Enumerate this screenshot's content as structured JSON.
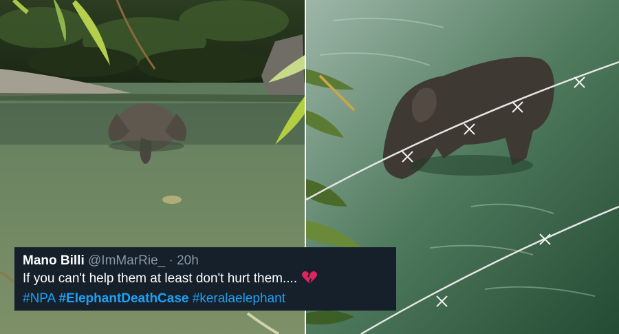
{
  "photos": {
    "left": {
      "icon": "elephant-in-river-photo"
    },
    "right": {
      "icon": "elephant-behind-barbed-wire-photo"
    }
  },
  "tweet": {
    "display_name": "Mano Billi",
    "handle": "@ImMarRie_",
    "separator": "·",
    "time": "20h",
    "text": "If you can't help them at least don't hurt them....",
    "emoji": "broken-heart-icon",
    "hashtags": [
      "#NPA",
      "#ElephantDeathCase",
      "#keralaelephant"
    ]
  },
  "colors": {
    "tweet_background": "#15202b",
    "handle_gray": "#8899a6",
    "hashtag_blue": "#1da1f2",
    "heart_red": "#e0245e"
  }
}
